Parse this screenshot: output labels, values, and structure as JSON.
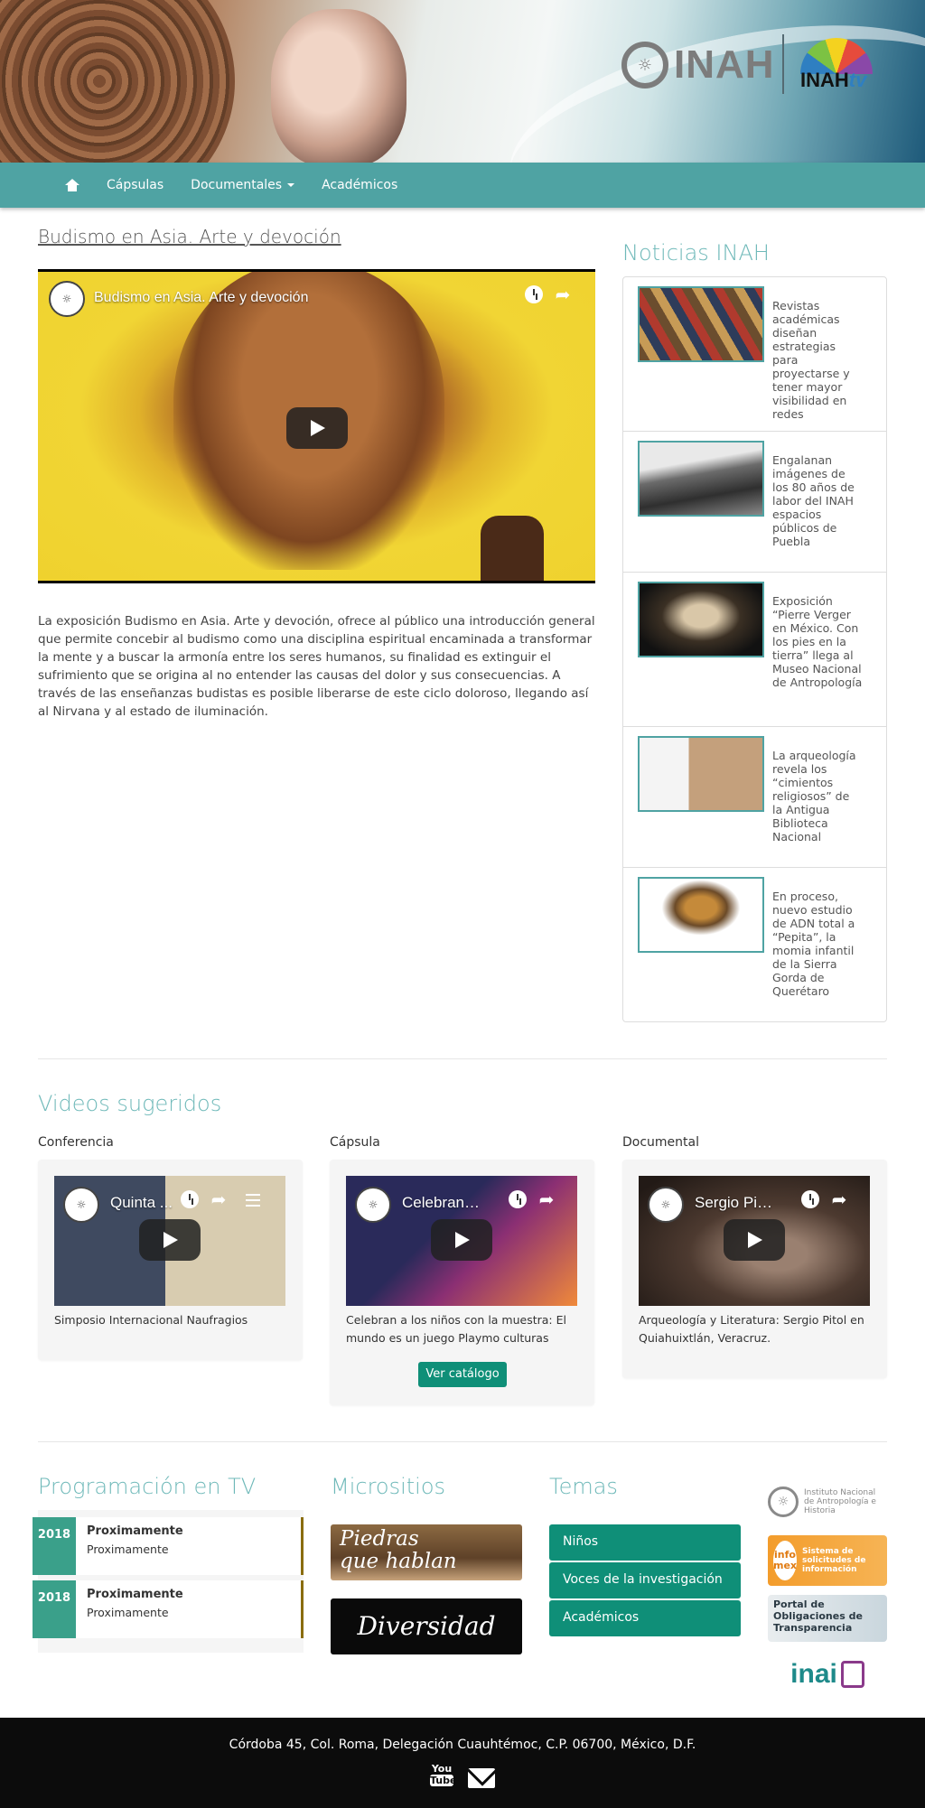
{
  "brand": {
    "inah_logo_text": "INAH",
    "inahtv_logo_main": "INAH",
    "inahtv_logo_suffix": "tv"
  },
  "nav": {
    "items": [
      {
        "label": "Cápsulas"
      },
      {
        "label": "Documentales"
      },
      {
        "label": "Académicos"
      }
    ]
  },
  "main": {
    "title": "Budismo en Asia. Arte y devoción",
    "video_title": "Budismo en Asia. Arte y devoción",
    "description": "La exposición Budismo en Asia. Arte y devoción, ofrece al público una introducción general que permite concebir al budismo como una disciplina espiritual encaminada a transformar la mente y a buscar la armonía entre los seres humanos, su finalidad es extinguir el sufrimiento que se origina al no entender las causas del dolor y sus consecuencias. A través de las enseñanzas budistas es posible liberarse de este ciclo doloroso, llegando así al Nirvana y al estado de iluminación."
  },
  "news": {
    "title": "Noticias INAH",
    "items": [
      {
        "text": "Revistas académicas diseñan estrategias para proyectarse y tener mayor visibilidad en redes"
      },
      {
        "text": "Engalanan imágenes de los 80 años de labor del INAH espacios públicos de Puebla"
      },
      {
        "text": "Exposición “Pierre Verger en México. Con los pies en la tierra” llega al Museo Nacional de Antropología"
      },
      {
        "text": "La arqueología revela los “cimientos religiosos” de la Antigua Biblioteca Nacional"
      },
      {
        "text": "En proceso, nuevo estudio de ADN total a “Pepita”, la momia infantil de la Sierra Gorda de Querétaro"
      }
    ]
  },
  "suggested": {
    "title": "Videos sugeridos",
    "cards": [
      {
        "label": "Conferencia",
        "video_title": "Quinta ...",
        "caption": "Simposio Internacional Naufragios"
      },
      {
        "label": "Cápsula",
        "video_title": "Celebran a l...",
        "caption": "Celebran a los niños con la muestra: El mundo es un juego Playmo culturas"
      },
      {
        "label": "Documental",
        "video_title": "Sergio Pitol ...",
        "caption": "Arqueología y Literatura: Sergio Pitol en Quiahuixtlán, Veracruz."
      }
    ],
    "catalog_button": "Ver catálogo"
  },
  "programming": {
    "title": "Programación en TV",
    "items": [
      {
        "year": "2018",
        "head": "Proximamente",
        "sub": "Proximamente"
      },
      {
        "year": "2018",
        "head": "Proximamente",
        "sub": "Proximamente"
      }
    ]
  },
  "microsites": {
    "title": "Micrositios",
    "items": [
      {
        "line1": "Piedras",
        "line2": "que hablan"
      },
      {
        "label": "Diversidad"
      }
    ]
  },
  "topics": {
    "title": "Temas",
    "items": [
      {
        "label": "Niños"
      },
      {
        "label": "Voces de la investigación"
      },
      {
        "label": "Académicos"
      }
    ]
  },
  "logos": {
    "inah_institutional": "Instituto Nacional de Antropología e Historia",
    "infomex_title": "info mex",
    "infomex_desc": "Sistema de solicitudes de información",
    "portal": "Portal de Obligaciones de Transparencia",
    "inai": "inai"
  },
  "footer": {
    "address": "Córdoba 45, Col. Roma, Delegación Cuauhtémoc, C.P. 06700, México, D.F.",
    "youtube_line1": "You",
    "youtube_line2": "Tube"
  },
  "colors": {
    "navbar": "#4fa3a3",
    "accent_title": "#6fb9b9",
    "button_green": "#0f8f78",
    "footer_bg": "#0c0c0c"
  }
}
